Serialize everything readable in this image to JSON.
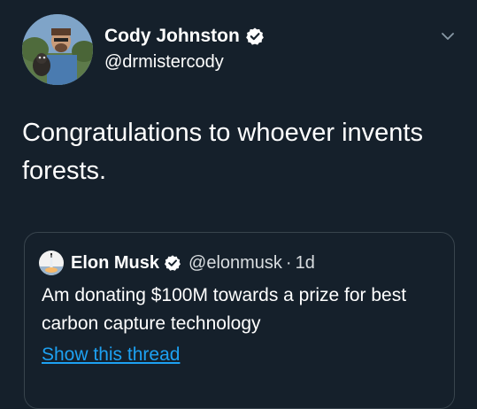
{
  "tweet": {
    "author": {
      "name": "Cody Johnston",
      "handle": "@drmistercody",
      "verified": true
    },
    "text": "Congratulations to whoever invents forests."
  },
  "quoted_tweet": {
    "author": {
      "name": "Elon Musk",
      "handle": "@elonmusk",
      "verified": true
    },
    "separator": "·",
    "time": "1d",
    "text": "Am donating $100M towards a prize for best carbon capture technology",
    "show_thread_label": "Show this thread"
  },
  "colors": {
    "background": "#15202b",
    "text": "#ffffff",
    "link": "#1da1f2",
    "border": "#38444d"
  },
  "icons": {
    "verified": "verified-badge-icon",
    "menu": "chevron-down-icon"
  }
}
